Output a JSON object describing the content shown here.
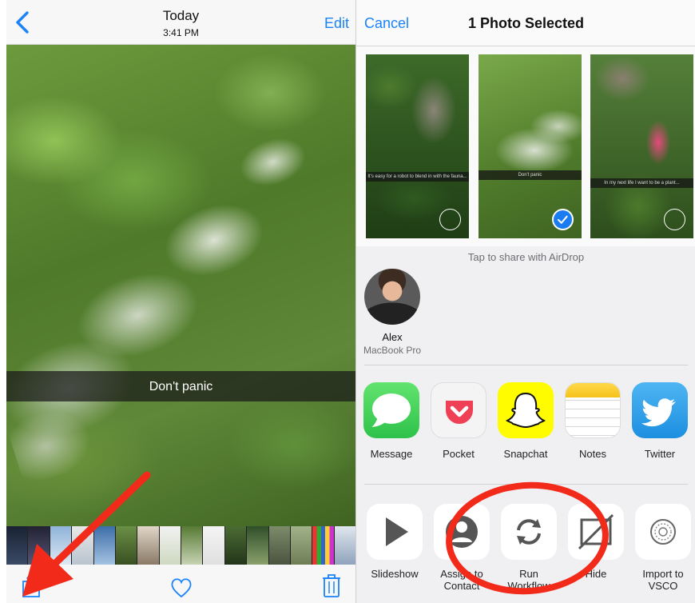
{
  "viewer": {
    "title": "Today",
    "time": "3:41 PM",
    "edit_label": "Edit",
    "caption": "Don't panic"
  },
  "share": {
    "cancel_label": "Cancel",
    "title": "1 Photo Selected",
    "photos": [
      {
        "caption": "It's easy for a robot to blend in with the fauna..."
      },
      {
        "caption": "Don't panic"
      },
      {
        "caption": "In my next life I want to be a plant..."
      }
    ],
    "airdrop_hint": "Tap to share with AirDrop",
    "airdrop_person": {
      "name": "Alex",
      "device": "MacBook Pro"
    },
    "apps": [
      {
        "label": "Message"
      },
      {
        "label": "Pocket"
      },
      {
        "label": "Snapchat"
      },
      {
        "label": "Notes"
      },
      {
        "label": "Twitter"
      }
    ],
    "actions": [
      {
        "label": "Slideshow"
      },
      {
        "label": "Assign to\nContact"
      },
      {
        "label": "Run\nWorkflow"
      },
      {
        "label": "Hide"
      },
      {
        "label": "Import to\nVSCO"
      }
    ]
  },
  "colors": {
    "ios_blue": "#1a82fb",
    "annotation_red": "#f22a1a",
    "messages_green": "#35d453",
    "pocket_red": "#ef4056",
    "snapchat_yellow": "#fffc00",
    "twitter_blue": "#1da1f2"
  },
  "icons": {
    "back": "chevron-left-icon",
    "share": "share-icon",
    "favorite": "heart-icon",
    "delete": "trash-icon"
  }
}
